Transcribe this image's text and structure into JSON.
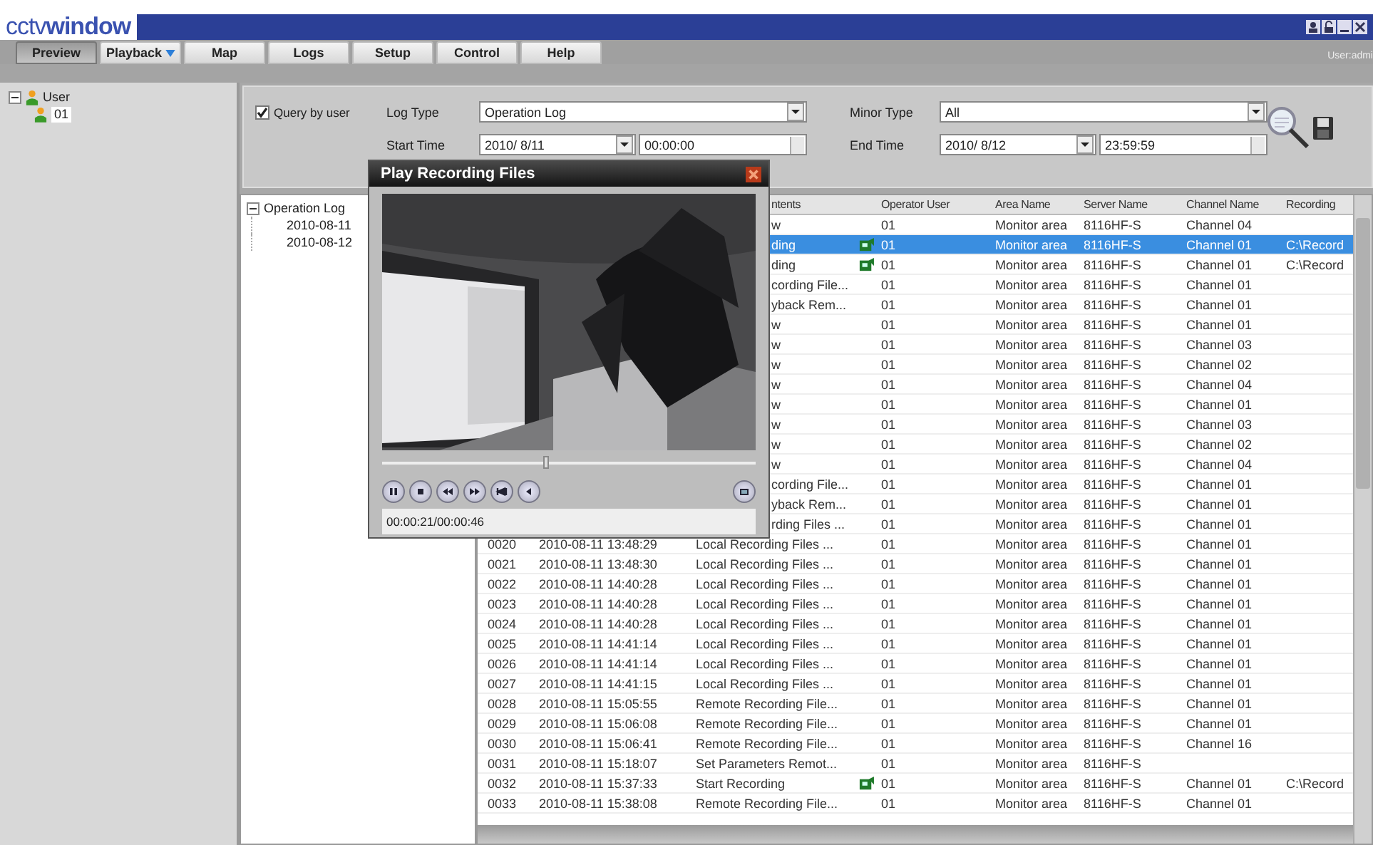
{
  "app": {
    "logo": "cctv**window**",
    "user_label": "User:admi"
  },
  "tabs": [
    {
      "label": "Preview",
      "selected": true,
      "dropdown": false
    },
    {
      "label": "Playback",
      "selected": false,
      "dropdown": true
    },
    {
      "label": "Map",
      "selected": false,
      "dropdown": false
    },
    {
      "label": "Logs",
      "selected": false,
      "dropdown": false
    },
    {
      "label": "Setup",
      "selected": false,
      "dropdown": false
    },
    {
      "label": "Control",
      "selected": false,
      "dropdown": false
    },
    {
      "label": "Help",
      "selected": false,
      "dropdown": false
    }
  ],
  "user_tree": {
    "label": "User",
    "expanded": true,
    "children": [
      {
        "label": "01"
      }
    ]
  },
  "filters": {
    "query_by_user": {
      "label": "Query by user",
      "checked": true
    },
    "log_type": {
      "label": "Log Type",
      "value": "Operation Log"
    },
    "minor_type": {
      "label": "Minor Type",
      "value": "All"
    },
    "start_time": {
      "label": "Start Time",
      "date": "2010/ 8/11",
      "time": "00:00:00"
    },
    "end_time": {
      "label": "End Time",
      "date": "2010/ 8/12",
      "time": "23:59:59"
    }
  },
  "log_tree": {
    "label": "Operation Log",
    "expanded": true,
    "children": [
      {
        "label": "2010-08-11"
      },
      {
        "label": "2010-08-12"
      }
    ]
  },
  "table": {
    "columns": [
      "ntents",
      "Operator User",
      "Area Name",
      "Server Name",
      "Channel Name",
      "Recording"
    ],
    "rows": [
      {
        "contents": "w",
        "record_icon": false,
        "user": "01",
        "area": "Monitor area",
        "server": "8116HF-S",
        "channel": "Channel 04",
        "selected": false
      },
      {
        "contents": "ding",
        "record_icon": true,
        "user": "01",
        "area": "Monitor area",
        "server": "8116HF-S",
        "channel": "Channel 01",
        "recording": "C:\\Record",
        "selected": true
      },
      {
        "contents": "ding",
        "record_icon": true,
        "user": "01",
        "area": "Monitor area",
        "server": "8116HF-S",
        "channel": "Channel 01",
        "recording": "C:\\Record",
        "selected": false
      },
      {
        "contents": "cording File...",
        "record_icon": false,
        "user": "01",
        "area": "Monitor area",
        "server": "8116HF-S",
        "channel": "Channel 01",
        "selected": false
      },
      {
        "contents": "yback Rem...",
        "record_icon": false,
        "user": "01",
        "area": "Monitor area",
        "server": "8116HF-S",
        "channel": "Channel 01",
        "selected": false
      },
      {
        "contents": "w",
        "record_icon": false,
        "user": "01",
        "area": "Monitor area",
        "server": "8116HF-S",
        "channel": "Channel 01",
        "selected": false
      },
      {
        "contents": "w",
        "record_icon": false,
        "user": "01",
        "area": "Monitor area",
        "server": "8116HF-S",
        "channel": "Channel 03",
        "selected": false
      },
      {
        "contents": "w",
        "record_icon": false,
        "user": "01",
        "area": "Monitor area",
        "server": "8116HF-S",
        "channel": "Channel 02",
        "selected": false
      },
      {
        "contents": "w",
        "record_icon": false,
        "user": "01",
        "area": "Monitor area",
        "server": "8116HF-S",
        "channel": "Channel 04",
        "selected": false
      },
      {
        "contents": "w",
        "record_icon": false,
        "user": "01",
        "area": "Monitor area",
        "server": "8116HF-S",
        "channel": "Channel 01",
        "selected": false
      },
      {
        "contents": "w",
        "record_icon": false,
        "user": "01",
        "area": "Monitor area",
        "server": "8116HF-S",
        "channel": "Channel 03",
        "selected": false
      },
      {
        "contents": "w",
        "record_icon": false,
        "user": "01",
        "area": "Monitor area",
        "server": "8116HF-S",
        "channel": "Channel 02",
        "selected": false
      },
      {
        "contents": "w",
        "record_icon": false,
        "user": "01",
        "area": "Monitor area",
        "server": "8116HF-S",
        "channel": "Channel 04",
        "selected": false
      },
      {
        "contents": "cording File...",
        "record_icon": false,
        "user": "01",
        "area": "Monitor area",
        "server": "8116HF-S",
        "channel": "Channel 01",
        "selected": false
      },
      {
        "contents": "yback Rem...",
        "record_icon": false,
        "user": "01",
        "area": "Monitor area",
        "server": "8116HF-S",
        "channel": "Channel 01",
        "selected": false
      },
      {
        "contents": "rding Files ...",
        "record_icon": false,
        "user": "01",
        "area": "Monitor area",
        "server": "8116HF-S",
        "channel": "Channel 01",
        "selected": false
      },
      {
        "no": "0020",
        "time": "2010-08-11 13:48:29",
        "contents": "Local Recording Files ...",
        "record_icon": false,
        "user": "01",
        "area": "Monitor area",
        "server": "8116HF-S",
        "channel": "Channel 01",
        "selected": false
      },
      {
        "no": "0021",
        "time": "2010-08-11 13:48:30",
        "contents": "Local Recording Files ...",
        "record_icon": false,
        "user": "01",
        "area": "Monitor area",
        "server": "8116HF-S",
        "channel": "Channel 01",
        "selected": false
      },
      {
        "no": "0022",
        "time": "2010-08-11 14:40:28",
        "contents": "Local Recording Files ...",
        "record_icon": false,
        "user": "01",
        "area": "Monitor area",
        "server": "8116HF-S",
        "channel": "Channel 01",
        "selected": false
      },
      {
        "no": "0023",
        "time": "2010-08-11 14:40:28",
        "contents": "Local Recording Files ...",
        "record_icon": false,
        "user": "01",
        "area": "Monitor area",
        "server": "8116HF-S",
        "channel": "Channel 01",
        "selected": false
      },
      {
        "no": "0024",
        "time": "2010-08-11 14:40:28",
        "contents": "Local Recording Files ...",
        "record_icon": false,
        "user": "01",
        "area": "Monitor area",
        "server": "8116HF-S",
        "channel": "Channel 01",
        "selected": false
      },
      {
        "no": "0025",
        "time": "2010-08-11 14:41:14",
        "contents": "Local Recording Files ...",
        "record_icon": false,
        "user": "01",
        "area": "Monitor area",
        "server": "8116HF-S",
        "channel": "Channel 01",
        "selected": false
      },
      {
        "no": "0026",
        "time": "2010-08-11 14:41:14",
        "contents": "Local Recording Files ...",
        "record_icon": false,
        "user": "01",
        "area": "Monitor area",
        "server": "8116HF-S",
        "channel": "Channel 01",
        "selected": false
      },
      {
        "no": "0027",
        "time": "2010-08-11 14:41:15",
        "contents": "Local Recording Files ...",
        "record_icon": false,
        "user": "01",
        "area": "Monitor area",
        "server": "8116HF-S",
        "channel": "Channel 01",
        "selected": false
      },
      {
        "no": "0028",
        "time": "2010-08-11 15:05:55",
        "contents": "Remote Recording File...",
        "record_icon": false,
        "user": "01",
        "area": "Monitor area",
        "server": "8116HF-S",
        "channel": "Channel 01",
        "selected": false
      },
      {
        "no": "0029",
        "time": "2010-08-11 15:06:08",
        "contents": "Remote Recording File...",
        "record_icon": false,
        "user": "01",
        "area": "Monitor area",
        "server": "8116HF-S",
        "channel": "Channel 01",
        "selected": false
      },
      {
        "no": "0030",
        "time": "2010-08-11 15:06:41",
        "contents": "Remote Recording File...",
        "record_icon": false,
        "user": "01",
        "area": "Monitor area",
        "server": "8116HF-S",
        "channel": "Channel 16",
        "selected": false
      },
      {
        "no": "0031",
        "time": "2010-08-11 15:18:07",
        "contents": "Set Parameters Remot...",
        "record_icon": false,
        "user": "01",
        "area": "Monitor area",
        "server": "8116HF-S",
        "selected": false
      },
      {
        "no": "0032",
        "time": "2010-08-11 15:37:33",
        "contents": "Start Recording",
        "record_icon": true,
        "user": "01",
        "area": "Monitor area",
        "server": "8116HF-S",
        "channel": "Channel 01",
        "recording": "C:\\Record",
        "selected": false
      },
      {
        "no": "0033",
        "time": "2010-08-11 15:38:08",
        "contents": "Remote Recording File...",
        "record_icon": false,
        "user": "01",
        "area": "Monitor area",
        "server": "8116HF-S",
        "channel": "Channel 01",
        "selected": false
      }
    ]
  },
  "player": {
    "title": "Play Recording Files",
    "progress": {
      "level": 0.44
    },
    "time": "00:00:21/00:00:46"
  }
}
